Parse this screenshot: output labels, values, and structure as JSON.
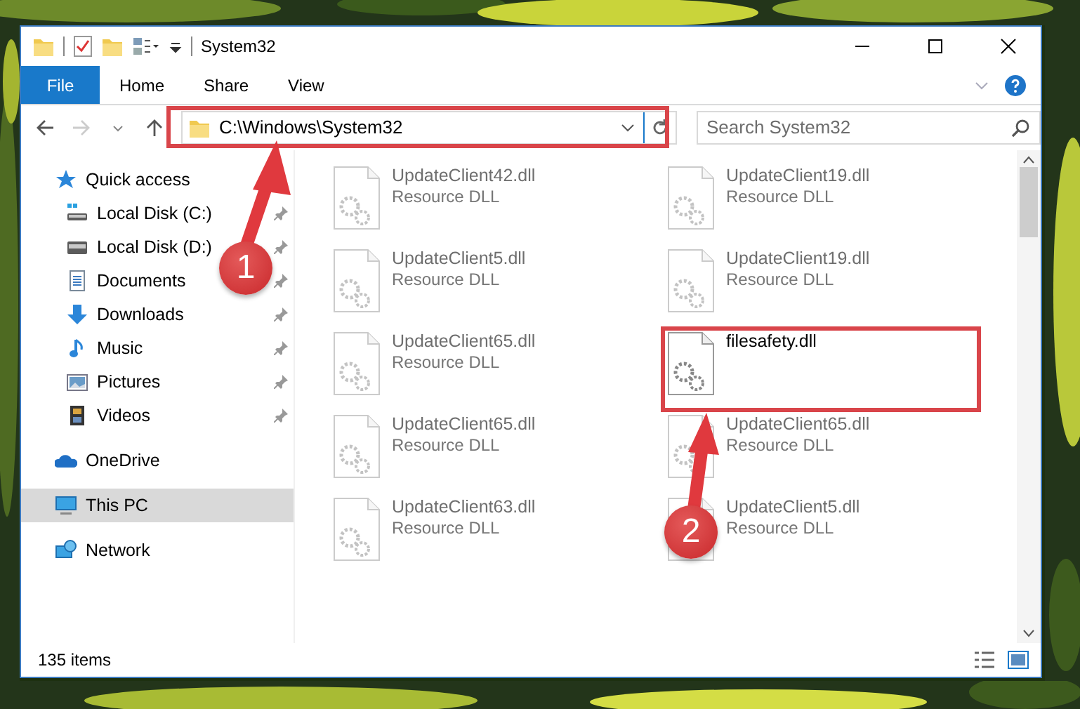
{
  "window": {
    "title": "System32"
  },
  "ribbon_tabs": [
    {
      "label": "File",
      "kind": "file_menu"
    },
    {
      "label": "Home",
      "kind": "tab"
    },
    {
      "label": "Share",
      "kind": "tab"
    },
    {
      "label": "View",
      "kind": "tab"
    }
  ],
  "address": {
    "path": "C:\\Windows\\System32"
  },
  "search": {
    "placeholder": "Search System32"
  },
  "sidebar": {
    "items": [
      {
        "label": "Quick access",
        "kind": "quick_access",
        "selected": false,
        "children": [
          {
            "label": "Local Disk (C:)",
            "kind": "system_drive",
            "pinned": true
          },
          {
            "label": "Local Disk (D:)",
            "kind": "drive",
            "pinned": true
          },
          {
            "label": "Documents",
            "kind": "documents",
            "pinned": true
          },
          {
            "label": "Downloads",
            "kind": "downloads",
            "pinned": true
          },
          {
            "label": "Music",
            "kind": "music",
            "pinned": true
          },
          {
            "label": "Pictures",
            "kind": "pictures",
            "pinned": true
          },
          {
            "label": "Videos",
            "kind": "videos",
            "pinned": true
          }
        ]
      },
      {
        "label": "OneDrive",
        "kind": "cloud",
        "selected": false
      },
      {
        "label": "This PC",
        "kind": "computer",
        "selected": true
      },
      {
        "label": "Network",
        "kind": "network",
        "selected": false
      }
    ]
  },
  "files": [
    {
      "name": "UpdateClient42.dll",
      "type": "Resource DLL",
      "dimmed": true
    },
    {
      "name": "UpdateClient19.dll",
      "type": "Resource DLL",
      "dimmed": true
    },
    {
      "name": "UpdateClient5.dll",
      "type": "Resource DLL",
      "dimmed": true
    },
    {
      "name": "UpdateClient19.dll",
      "type": "Resource DLL",
      "dimmed": true
    },
    {
      "name": "UpdateClient65.dll",
      "type": "Resource DLL",
      "dimmed": true
    },
    {
      "name": "filesafety.dll",
      "dimmed": false
    },
    {
      "name": "UpdateClient65.dll",
      "type": "Resource DLL",
      "dimmed": true
    },
    {
      "name": "UpdateClient65.dll",
      "type": "Resource DLL",
      "dimmed": true
    },
    {
      "name": "UpdateClient63.dll",
      "type": "Resource DLL",
      "dimmed": true
    },
    {
      "name": "UpdateClient5.dll",
      "type": "Resource DLL",
      "dimmed": true
    }
  ],
  "status_bar": {
    "count": "135 items"
  },
  "annotations": [
    {
      "number": "1"
    },
    {
      "number": "2"
    }
  ]
}
